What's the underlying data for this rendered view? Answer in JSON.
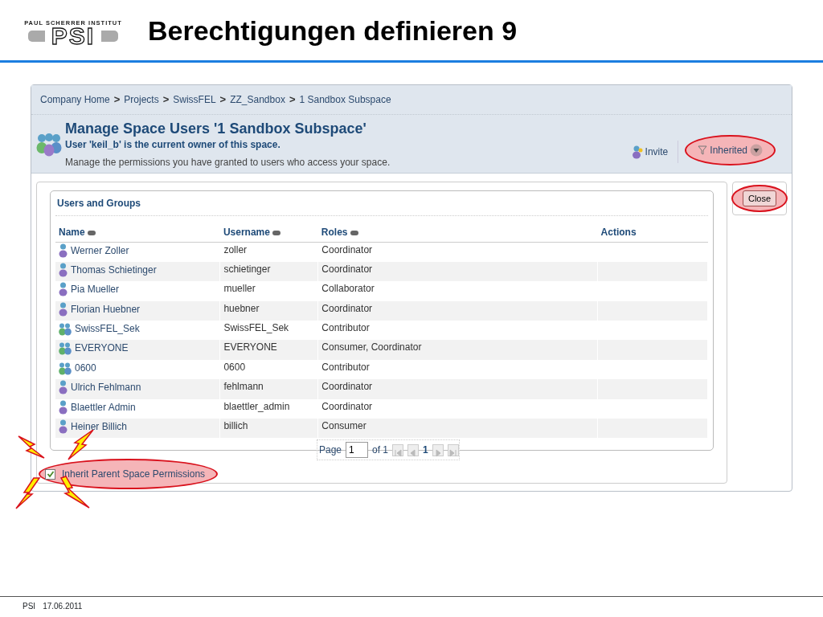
{
  "slide": {
    "logo_caption": "PAUL SCHERRER INSTITUT",
    "logo_letters": "PSI",
    "title": "Berechtigungen definieren 9"
  },
  "breadcrumb": [
    "Company Home",
    "Projects",
    "SwissFEL",
    "ZZ_Sandbox",
    "1 Sandbox Subspace"
  ],
  "breadcrumb_separator": ">",
  "header": {
    "title": "Manage Space Users '1 Sandbox Subspace'",
    "owner": "User 'keil_b' is the current owner of this space.",
    "description": "Manage the permissions you have granted to users who access your space."
  },
  "toolbar": {
    "invite": "Invite",
    "inherited": {
      "label": "Inherited",
      "highlighted": true
    }
  },
  "close_button": {
    "label": "Close",
    "highlighted": true
  },
  "panel": {
    "title": "Users and Groups",
    "columns": [
      {
        "label": "Name",
        "sortable": true
      },
      {
        "label": "Username",
        "sortable": true
      },
      {
        "label": "Roles",
        "sortable": true
      },
      {
        "label": "Actions",
        "sortable": false
      }
    ],
    "rows": [
      {
        "kind": "user",
        "name": "Werner Zoller",
        "username": "zoller",
        "roles": "Coordinator"
      },
      {
        "kind": "user",
        "name": "Thomas Schietinger",
        "username": "schietinger",
        "roles": "Coordinator"
      },
      {
        "kind": "user",
        "name": "Pia Mueller",
        "username": "mueller",
        "roles": "Collaborator"
      },
      {
        "kind": "user",
        "name": "Florian Huebner",
        "username": "huebner",
        "roles": "Coordinator"
      },
      {
        "kind": "group",
        "name": "SwissFEL_Sek",
        "username": "SwissFEL_Sek",
        "roles": "Contributor"
      },
      {
        "kind": "group",
        "name": "EVERYONE",
        "username": "EVERYONE",
        "roles": "Consumer, Coordinator"
      },
      {
        "kind": "group",
        "name": "0600",
        "username": "0600",
        "roles": "Contributor"
      },
      {
        "kind": "user",
        "name": "Ulrich Fehlmann",
        "username": "fehlmann",
        "roles": "Coordinator"
      },
      {
        "kind": "user",
        "name": "Blaettler Admin",
        "username": "blaettler_admin",
        "roles": "Coordinator"
      },
      {
        "kind": "user",
        "name": "Heiner Billich",
        "username": "billich",
        "roles": "Consumer"
      }
    ],
    "pager": {
      "label": "Page",
      "value": "1",
      "of": "of 1",
      "current": "1"
    }
  },
  "inherit": {
    "label": "Inherit Parent Space Permissions",
    "checked": true,
    "highlighted": true
  },
  "footer": {
    "org": "PSI",
    "date": "17.06.2011"
  }
}
